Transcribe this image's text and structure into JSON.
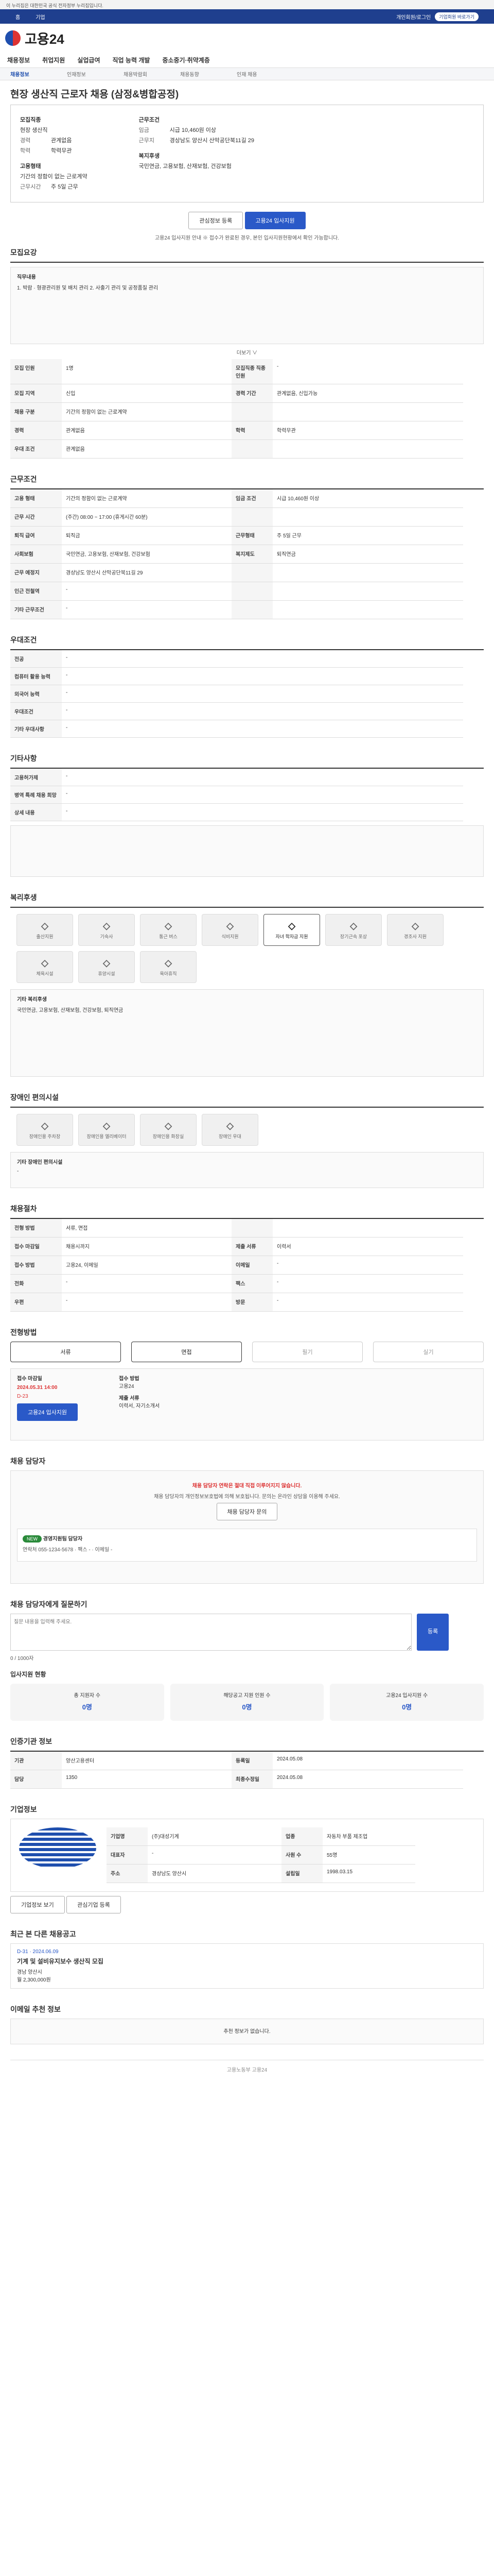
{
  "gov": "이 누리집은 대한민국 공식 전자정부 누리집입니다.",
  "top": {
    "home": "홈",
    "ent": "기업",
    "sw": "개인회원/로그인",
    "enter": "기업회원 바로가기"
  },
  "brand": "고용24",
  "gnb": [
    "채용정보",
    "취업지원",
    "실업급여",
    "직업 능력 개발",
    "중소중기·취약계층"
  ],
  "sub": [
    "채용정보",
    "인재정보",
    "채용박람회",
    "채용동향",
    "인재 채용"
  ],
  "title": "현장 생산직 근로자 채용 (삼정&병합공정)",
  "summary": {
    "h1": "모집직종",
    "v1": "현장 생산직",
    "h2": "근무조건",
    "l_pay": "임금",
    "v_pay": "시급 10,460원 이상",
    "l_loc": "근무지",
    "v_loc": "경상남도 양산시 산막공단북11길 29",
    "l_emp": "고용형태",
    "v_emp": "기간의 정함이 없는 근로계약",
    "l_hours": "근무시간",
    "v_hours": "주 5일 근무",
    "l_career": "경력",
    "v_career": "관계없음",
    "l_edu": "학력",
    "v_edu": "학력무관",
    "h3": "복지후생",
    "v_welfare": "국민연금, 고용보험, 산재보험, 건강보험"
  },
  "actions": {
    "fav": "관심정보 등록",
    "apply": "고용24 입사지원"
  },
  "note": "고용24 입사지원 안내 ※ 접수가 완료된 경우, 본인 입사지원현황에서 확인 가능합니다.",
  "s1": {
    "title": "모집요강",
    "dutiesTitle": "직무내용",
    "duties": "1. 박람 · 형광관리원 및 배치 관리 2. 사출기 관리 및 공정품질 관리",
    "more": "더보기 ∨",
    "rows": [
      [
        "모집 인원",
        "1명",
        "모집직종 직종 인원",
        "-"
      ],
      [
        "모집 지역",
        "신입",
        "경력 기간",
        "관계없음, 신입가능"
      ],
      [
        "채용 구분",
        "기간의 정함이 없는 근로계약",
        "",
        ""
      ],
      [
        "경력",
        "관계없음",
        "학력",
        "학력무관"
      ],
      [
        "우대 조건",
        "관계없음",
        "",
        ""
      ]
    ]
  },
  "s2": {
    "title": "근무조건",
    "rows": [
      [
        "고용 형태",
        "기간의 정함이 없는 근로계약",
        "임금 조건",
        "시급 10,460원 이상"
      ],
      [
        "근무 시간",
        "(주간) 08:00 ~ 17:00 (휴게시간 60분)",
        "",
        ""
      ],
      [
        "퇴직 급여",
        "퇴직금",
        "근무형태",
        "주 5일 근무"
      ],
      [
        "사회보험",
        "국민연금, 고용보험, 산재보험, 건강보험",
        "복지제도",
        "퇴직연금"
      ],
      [
        "근무 예정지",
        "경상남도 양산시 산막공단북11길 29",
        "",
        ""
      ],
      [
        "인근 전철역",
        "-",
        "",
        ""
      ],
      [
        "기타 근무조건",
        "-",
        "",
        ""
      ]
    ]
  },
  "s3": {
    "title": "우대조건",
    "rows": [
      [
        "전공",
        "-"
      ],
      [
        "컴퓨터 활용 능력",
        "-"
      ],
      [
        "외국어 능력",
        "-"
      ],
      [
        "우대조건",
        "-"
      ],
      [
        "기타 우대사항",
        "-"
      ]
    ]
  },
  "s4": {
    "title": "기타사항",
    "rows": [
      [
        "고용허가제",
        "-"
      ],
      [
        "병역 특례 채용 희망",
        "-"
      ],
      [
        "상세 내용",
        "-"
      ]
    ]
  },
  "s5": {
    "title": "복리후생",
    "icons": [
      "출산지원",
      "기숙사",
      "통근 버스",
      "식비지원",
      "자녀 학자금 지원",
      "장기근속 포상",
      "경조사 지원",
      "체육시설",
      "휴양시설",
      "육아휴직"
    ],
    "etc_title": "기타 복리후생",
    "etc": "국민연금, 고용보험, 산재보험, 건강보험, 퇴직연금"
  },
  "s6": {
    "title": "장애인 편의시설",
    "icons": [
      "장애인용 주차장",
      "장애인용 엘리베이터",
      "장애인용 화장실",
      "장애인 우대"
    ],
    "etc_title": "기타 장애인 편의시설",
    "etc": "-"
  },
  "s7": {
    "title": "채용절차",
    "rows": [
      [
        "전형 방법",
        "서류, 면접",
        "",
        ""
      ],
      [
        "접수 마감일",
        "채용시까지",
        "제출 서류",
        "이력서"
      ],
      [
        "접수 방법",
        "고용24, 이메일",
        "이메일",
        "-"
      ],
      [
        "전화",
        "-",
        "팩스",
        "-"
      ],
      [
        "우편",
        "-",
        "방문",
        "-"
      ]
    ]
  },
  "s8": {
    "title": "전형방법",
    "tabs": [
      "서류",
      "면접",
      "필기",
      "실기"
    ],
    "deadline": "접수 마감일",
    "date": "2024.05.31 14:00",
    "dday": "D-23",
    "apply": "고용24 입사지원",
    "r": "접수 방법",
    "rv": "고용24",
    "s": "제출 서류",
    "sv": "이력서, 자기소개서"
  },
  "s9": {
    "title": "채용 담당자",
    "warn": "채용 담당자 연락은 절대 직접 이루어지지 않습니다.",
    "desc": "채용 담당자의 개인정보보호법에 의해 보호됩니다. 문의는 온라인 상담을 이용해 주세요.",
    "btn": "채용 담당자 문의",
    "tag": "NEW",
    "dept": "경영지원팀 담당자",
    "tel": "연락처",
    "telv": "055-1234-5678",
    "fax": "팩스",
    "faxv": "-",
    "email": "이메일",
    "emailv": "-"
  },
  "s10": {
    "title": "채용 담당자에게 질문하기",
    "ph": "질문 내용을 입력해 주세요.",
    "count": "0 / 1000자",
    "ok": "등록"
  },
  "s11": {
    "title": "입사지원 현황",
    "items": [
      [
        "총 지원자 수",
        "0명"
      ],
      [
        "해당공고 지원 인원 수",
        "0명"
      ],
      [
        "고용24 입사지원 수",
        "0명"
      ]
    ]
  },
  "s12": {
    "title": "인증기관 정보",
    "rows": [
      [
        "기관",
        "양산고용센터",
        "등록일",
        "2024.05.08"
      ],
      [
        "담당",
        "1350",
        "최종수정일",
        "2024.05.08"
      ]
    ]
  },
  "s13": {
    "title": "기업정보",
    "rows": [
      [
        "기업명",
        "(주)대성기계",
        "업종",
        "자동차 부품 제조업"
      ],
      [
        "대표자",
        "-",
        "사원 수",
        "55명"
      ],
      [
        "주소",
        "경상남도 양산시",
        "설립일",
        "1998.03.15"
      ]
    ],
    "btn1": "기업정보 보기",
    "btn2": "관심기업 등록"
  },
  "s14": {
    "title": "최근 본 다른 채용공고",
    "date": "D-31 · 2024.06.09",
    "job": "기계 및 설비유지보수 생산직 모집",
    "loc": "경남 양산시",
    "pay": "월 2,300,000원"
  },
  "s15": {
    "title": "이메일 추천 정보",
    "msg": "추천 정보가 없습니다."
  },
  "foot": "고용노동부 고용24"
}
